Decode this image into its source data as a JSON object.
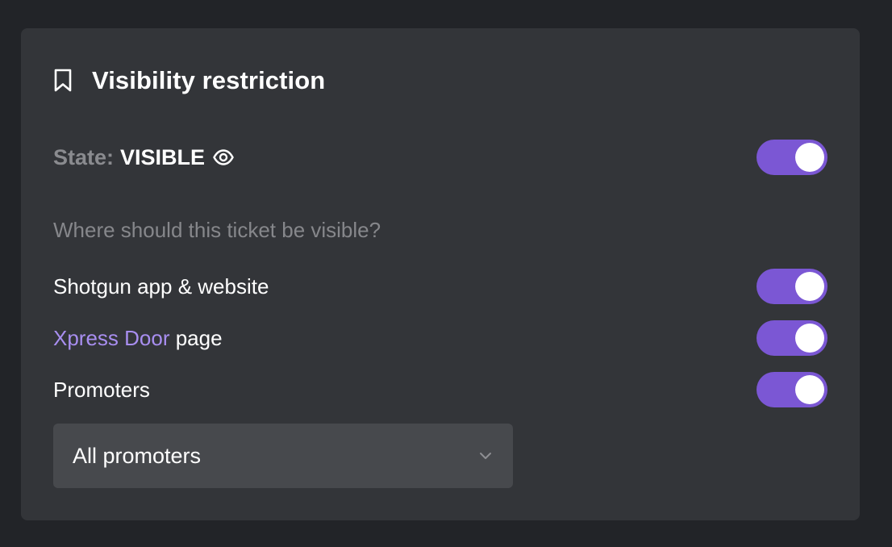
{
  "panel": {
    "title": "Visibility restriction",
    "title_icon": "bookmark-icon"
  },
  "state": {
    "label": "State:",
    "value": "VISIBLE",
    "icon": "eye-icon",
    "toggle_on": true
  },
  "question": "Where should this ticket be visible?",
  "options": [
    {
      "label": "Shotgun app & website",
      "toggle_on": true
    },
    {
      "link_text": "Xpress Door",
      "label_suffix": " page",
      "toggle_on": true
    },
    {
      "label": "Promoters",
      "toggle_on": true
    }
  ],
  "promoters_select": {
    "value": "All promoters",
    "icon": "chevron-down-icon"
  },
  "colors": {
    "background": "#222428",
    "card": "#333539",
    "accent": "#7b57d4",
    "link": "#a88ef0",
    "muted_text": "#86878b",
    "select_bg": "#47494d"
  }
}
